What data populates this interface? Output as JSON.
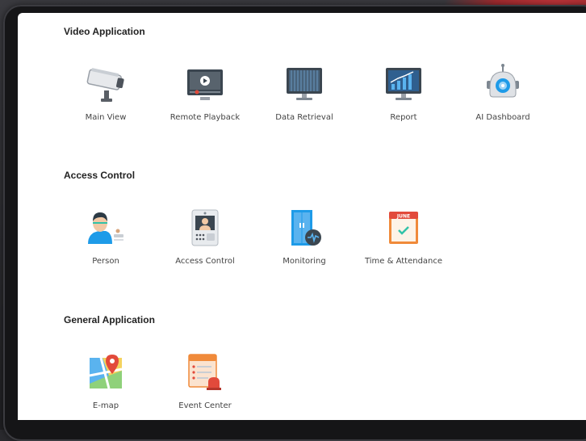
{
  "sections": [
    {
      "title": "Video Application",
      "apps": [
        {
          "label": "Main View",
          "icon": "camera-icon"
        },
        {
          "label": "Remote Playback",
          "icon": "playback-monitor-icon"
        },
        {
          "label": "Data Retrieval",
          "icon": "data-monitor-icon"
        },
        {
          "label": "Report",
          "icon": "bar-chart-monitor-icon"
        },
        {
          "label": "AI Dashboard",
          "icon": "robot-icon"
        }
      ]
    },
    {
      "title": "Access Control",
      "apps": [
        {
          "label": "Person",
          "icon": "person-face-icon"
        },
        {
          "label": "Access Control",
          "icon": "door-terminal-icon"
        },
        {
          "label": "Monitoring",
          "icon": "door-monitoring-icon"
        },
        {
          "label": "Time & Attendance",
          "icon": "calendar-check-icon",
          "calendar_month": "JUNE"
        }
      ]
    },
    {
      "title": "General Application",
      "apps": [
        {
          "label": "E-map",
          "icon": "map-pin-icon"
        },
        {
          "label": "Event Center",
          "icon": "event-alarm-icon"
        }
      ]
    }
  ],
  "colors": {
    "accent_blue": "#1e9be8",
    "accent_red": "#e24a3b",
    "accent_orange": "#f08a3a",
    "monitor_dark": "#3b4650"
  }
}
